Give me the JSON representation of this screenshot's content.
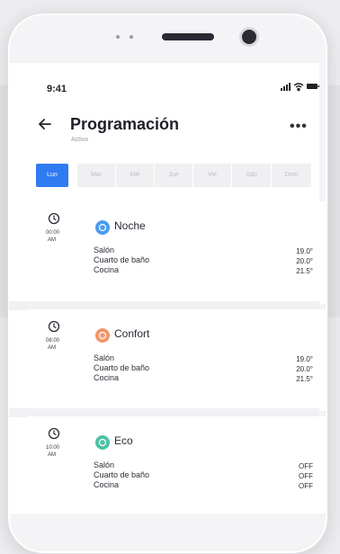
{
  "status_bar": {
    "time": "9:41"
  },
  "header": {
    "title": "Programación",
    "subtitle": "Activo",
    "more": "•••"
  },
  "days": [
    "Lun",
    "Mar",
    "Mié",
    "Jue",
    "Vie",
    "Sáb",
    "Dom"
  ],
  "selected_day": "Lun",
  "schedules": [
    {
      "time": "00:00",
      "period": "AM",
      "mode": "Noche",
      "mode_color": "#4a9cf0",
      "rooms": [
        {
          "name": "Salón",
          "value": "19.0°"
        },
        {
          "name": "Cuarto de baño",
          "value": "20.0°"
        },
        {
          "name": "Cocina",
          "value": "21.5°"
        }
      ]
    },
    {
      "time": "08:00",
      "period": "AM",
      "mode": "Confort",
      "mode_color": "#f0976a",
      "rooms": [
        {
          "name": "Salón",
          "value": "19.0°"
        },
        {
          "name": "Cuarto de baño",
          "value": "20.0°"
        },
        {
          "name": "Cocina",
          "value": "21.5°"
        }
      ]
    },
    {
      "time": "10:00",
      "period": "AM",
      "mode": "Eco",
      "mode_color": "#4fc2a3",
      "rooms": [
        {
          "name": "Salón",
          "value": "OFF"
        },
        {
          "name": "Cuarto de baño",
          "value": "OFF"
        },
        {
          "name": "Cocina",
          "value": "OFF"
        }
      ]
    }
  ]
}
